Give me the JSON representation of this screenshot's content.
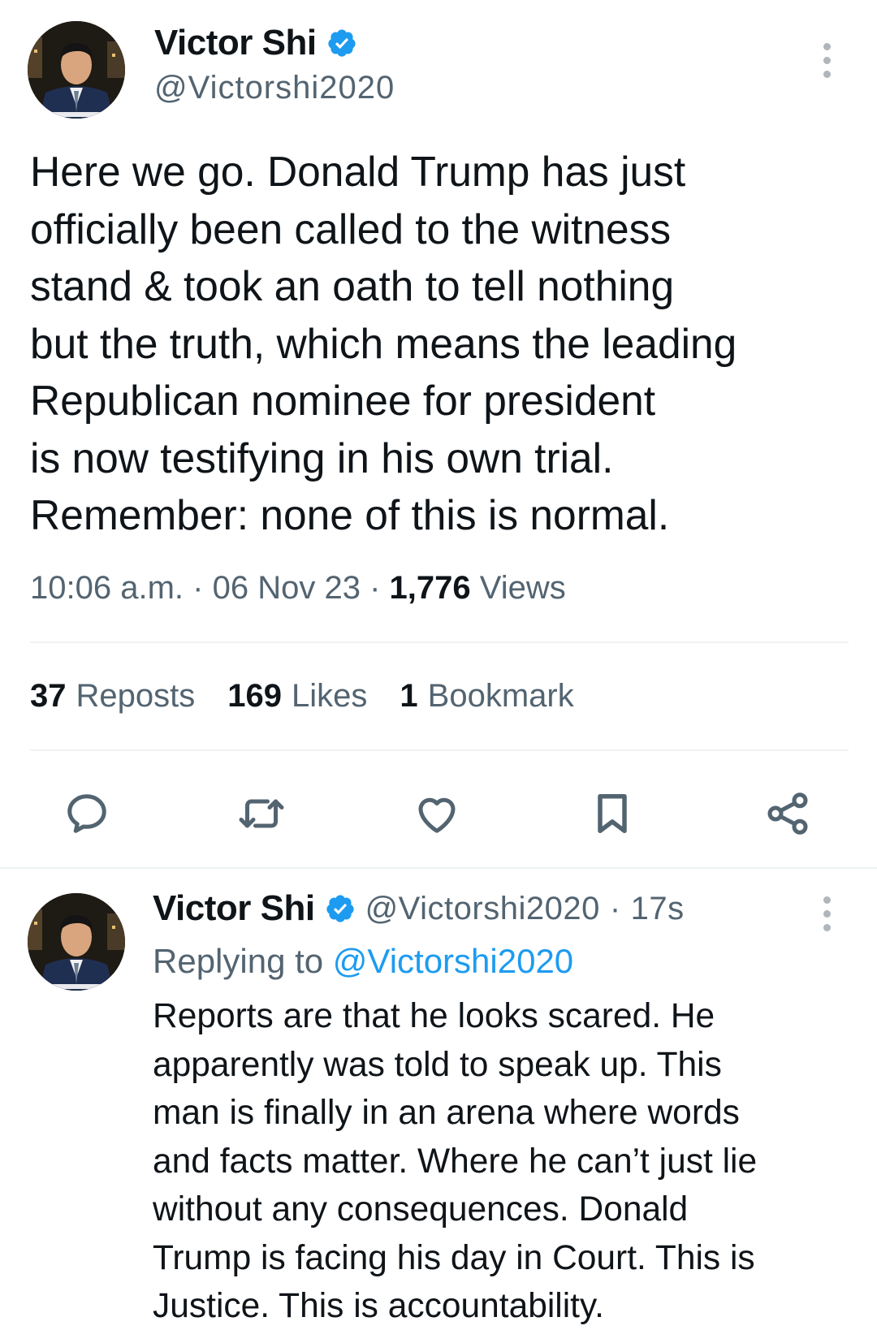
{
  "main_tweet": {
    "author_name": "Victor Shi",
    "author_handle": "@Victorshi2020",
    "text": "Here we go. Donald Trump has just\nofficially been called to the witness\nstand & took an oath to tell nothing\nbut the truth, which means the leading\nRepublican nominee for president\nis now testifying in his own trial.\nRemember: none of this is normal.",
    "time": "10:06 a.m.",
    "separator": "·",
    "date": "06 Nov 23",
    "views_count": "1,776",
    "views_label": "Views"
  },
  "stats": {
    "reposts_count": "37",
    "reposts_label": "Reposts",
    "likes_count": "169",
    "likes_label": "Likes",
    "bookmarks_count": "1",
    "bookmarks_label": "Bookmark"
  },
  "actions": {
    "icons": [
      "reply-icon",
      "repost-icon",
      "like-icon",
      "bookmark-icon",
      "share-icon"
    ]
  },
  "reply_tweet": {
    "author_name": "Victor Shi",
    "author_handle": "@Victorshi2020",
    "separator": "·",
    "age": "17s",
    "replying_prefix": "Replying to",
    "replying_to": "@Victorshi2020",
    "text": "Reports are that he looks scared. He\napparently was told to speak up. This\nman is finally in an arena where words\nand facts matter. Where he can’t just lie\nwithout any consequences. Donald\nTrump is facing his day in Court. This is\nJustice. This is accountability."
  },
  "colors": {
    "text_primary": "#0f1419",
    "text_secondary": "#536471",
    "accent_blue": "#1d9bf0",
    "divider": "#eff3f4"
  }
}
